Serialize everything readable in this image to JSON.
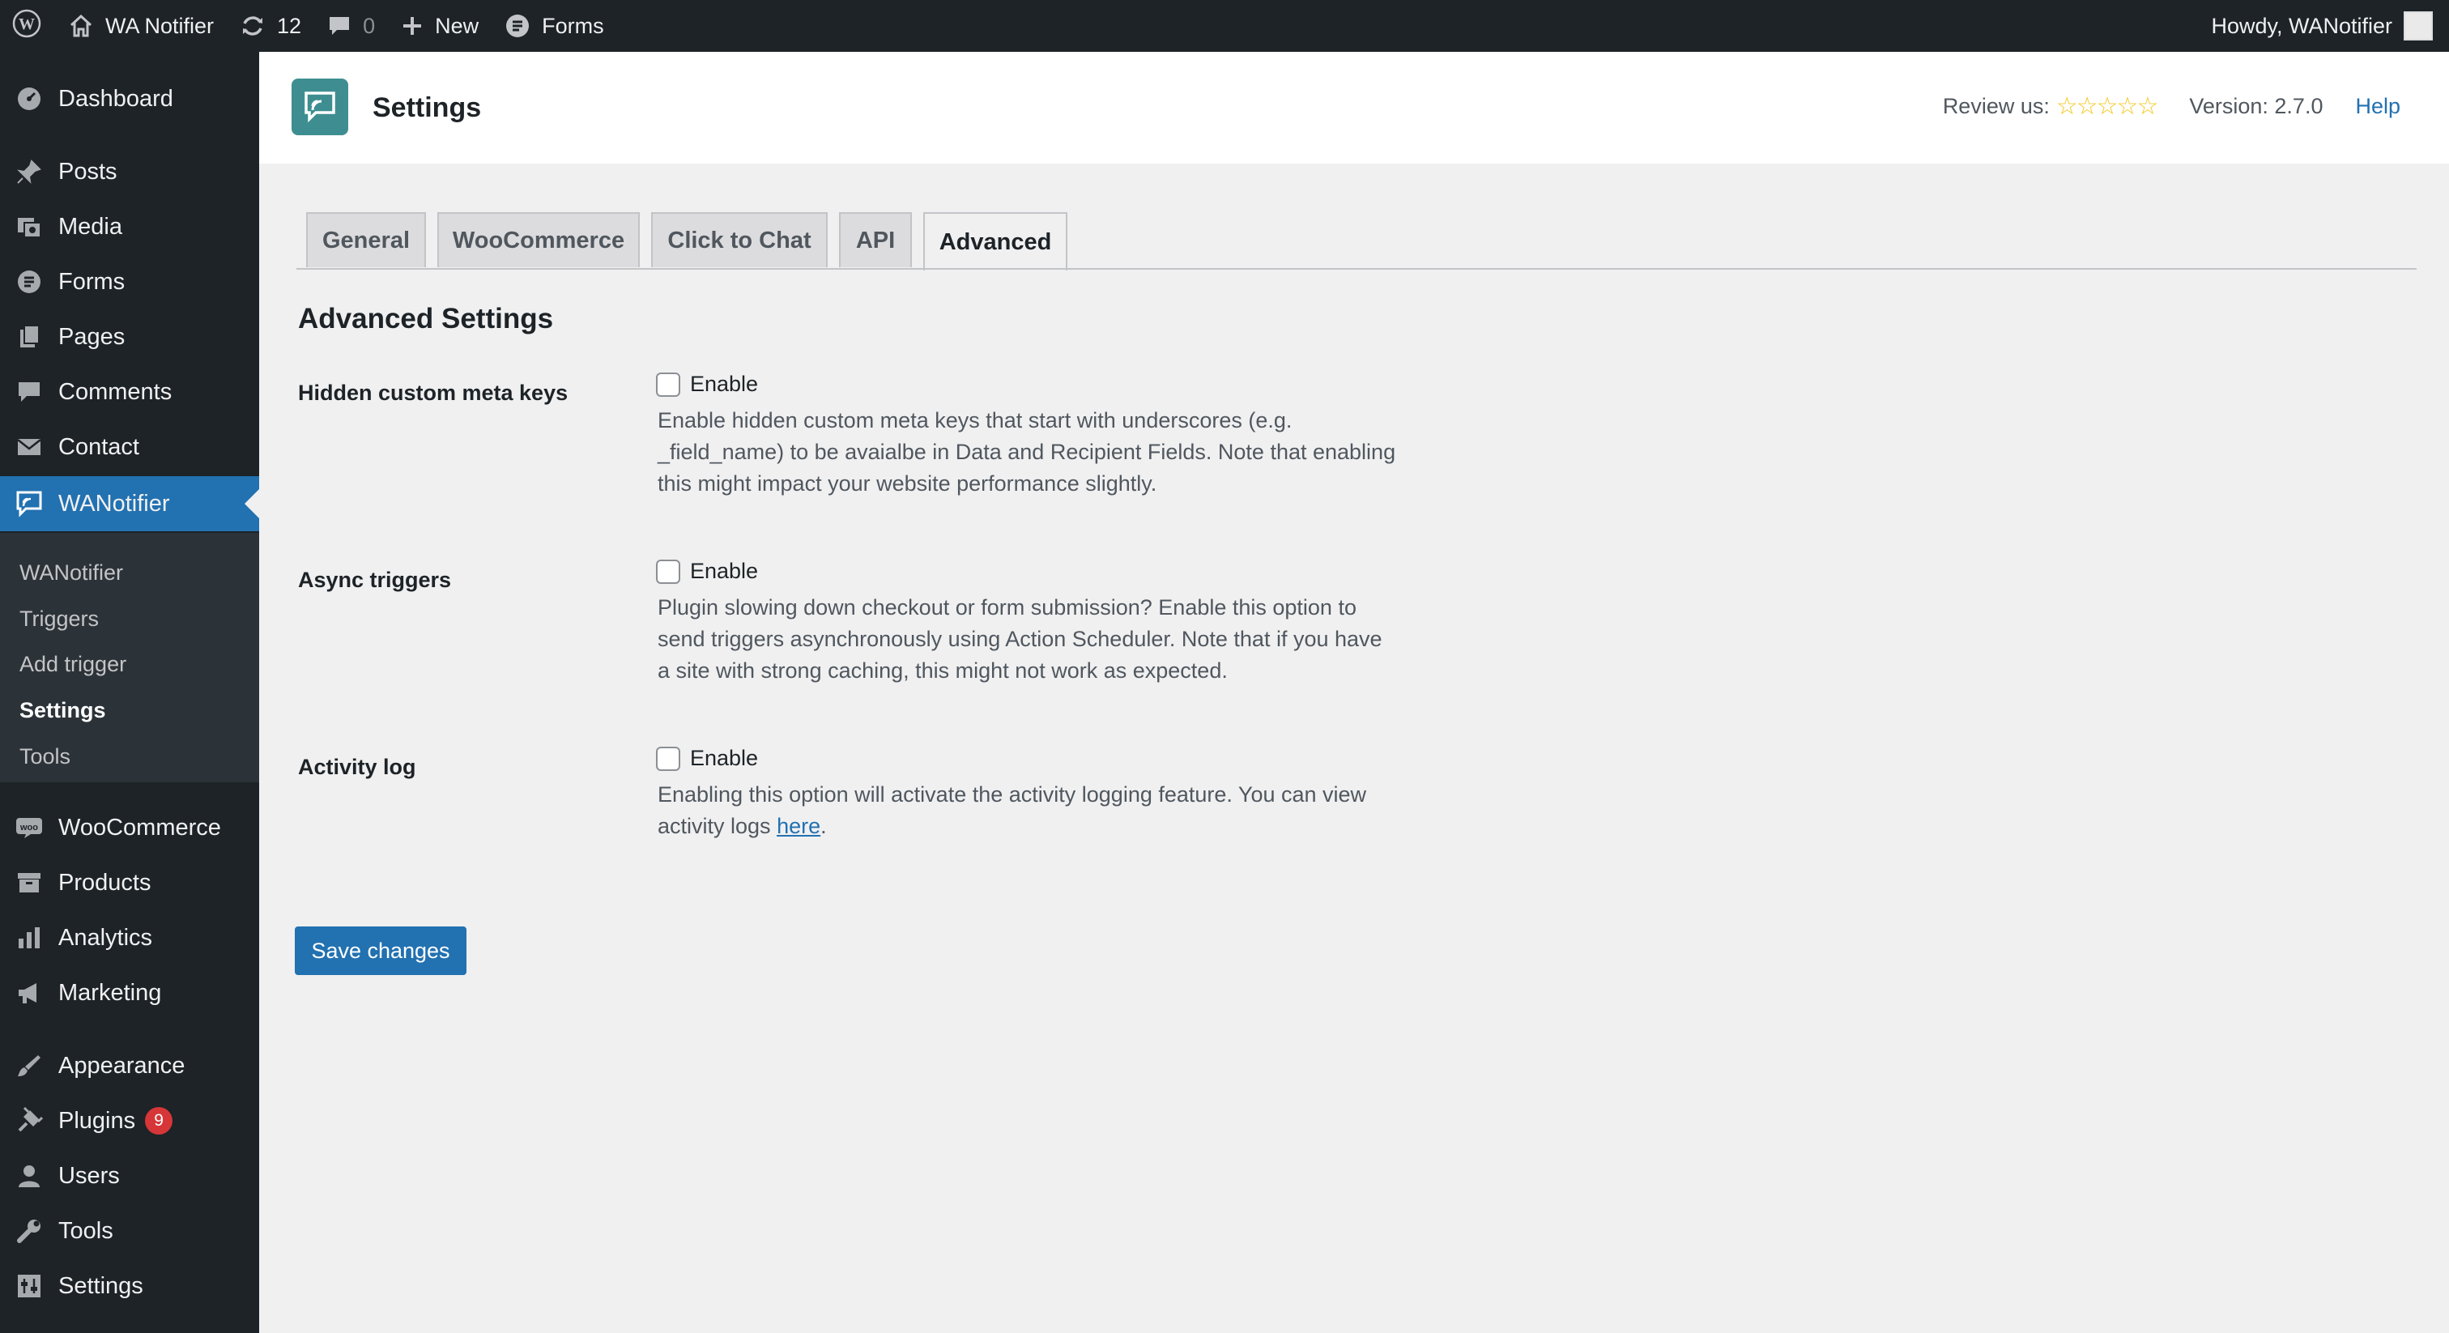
{
  "adminbar": {
    "site_name": "WA Notifier",
    "updates_count": "12",
    "comments_count": "0",
    "new_label": "New",
    "forms_label": "Forms",
    "greeting": "Howdy, WANotifier"
  },
  "sidebar": {
    "items": [
      {
        "label": "Dashboard",
        "icon": "dashboard-icon"
      },
      {
        "label": "Posts",
        "icon": "pin-icon"
      },
      {
        "label": "Media",
        "icon": "media-icon"
      },
      {
        "label": "Forms",
        "icon": "forms-icon"
      },
      {
        "label": "Pages",
        "icon": "pages-icon"
      },
      {
        "label": "Comments",
        "icon": "comment-icon"
      },
      {
        "label": "Contact",
        "icon": "mail-icon"
      },
      {
        "label": "WANotifier",
        "icon": "chat-icon"
      },
      {
        "label": "WooCommerce",
        "icon": "woo-icon"
      },
      {
        "label": "Products",
        "icon": "archive-icon"
      },
      {
        "label": "Analytics",
        "icon": "bar-chart-icon"
      },
      {
        "label": "Marketing",
        "icon": "megaphone-icon"
      },
      {
        "label": "Appearance",
        "icon": "brush-icon"
      },
      {
        "label": "Plugins",
        "icon": "plug-icon",
        "badge": "9"
      },
      {
        "label": "Users",
        "icon": "user-icon"
      },
      {
        "label": "Tools",
        "icon": "wrench-icon"
      },
      {
        "label": "Settings",
        "icon": "sliders-icon"
      }
    ],
    "submenu": [
      "WANotifier",
      "Triggers",
      "Add trigger",
      "Settings",
      "Tools"
    ]
  },
  "header": {
    "title": "Settings",
    "review_label": "Review us:",
    "stars": "☆☆☆☆☆",
    "version": "Version: 2.7.0",
    "help": "Help"
  },
  "tabs": [
    "General",
    "WooCommerce",
    "Click to Chat",
    "API",
    "Advanced"
  ],
  "active_tab": "Advanced",
  "section_title": "Advanced Settings",
  "settings": [
    {
      "label": "Hidden custom meta keys",
      "enable_label": "Enable",
      "checked": false,
      "description_lines": [
        "Enable hidden custom meta keys that start with underscores (e.g.",
        "_field_name) to be avaialbe in Data and Recipient Fields. Note that enabling",
        "this might impact your website performance slightly."
      ]
    },
    {
      "label": "Async triggers",
      "enable_label": "Enable",
      "checked": false,
      "description_lines": [
        "Plugin slowing down checkout or form submission? Enable this option to",
        "send triggers asynchronously using Action Scheduler. Note that if you have",
        "a site with strong caching, this might not work as expected."
      ]
    },
    {
      "label": "Activity log",
      "enable_label": "Enable",
      "checked": false,
      "description_line1": "Enabling this option will activate the activity logging feature. You can view",
      "description_prefix": "activity logs ",
      "link_text": "here",
      "description_suffix": "."
    }
  ],
  "save_button": "Save changes",
  "colors": {
    "admin_dark": "#1d2327",
    "submenu_bg": "#2c3338",
    "accent": "#2271b1",
    "plugin_logo": "#3e8e91",
    "badge_red": "#d63638"
  }
}
